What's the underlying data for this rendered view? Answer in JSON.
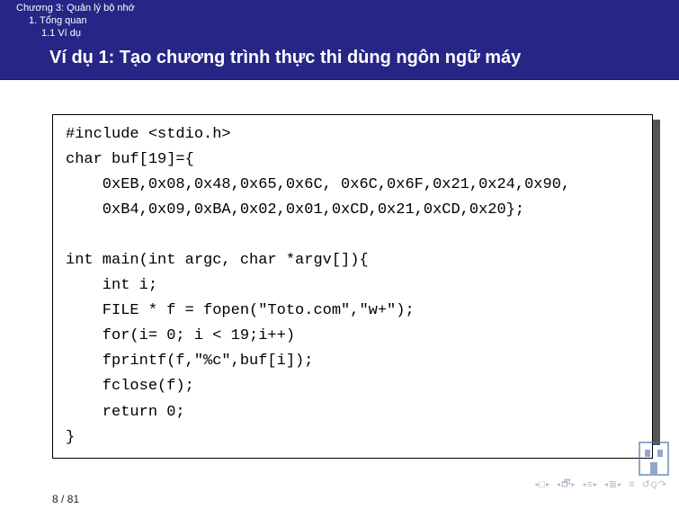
{
  "header": {
    "chapter": "Chương 3: Quản lý bộ nhớ",
    "section": "1. Tổng quan",
    "subsection": "1.1 Ví dụ"
  },
  "title": "Ví dụ 1: Tạo chương trình thực thi dùng ngôn ngữ máy",
  "code_lines": [
    "#include <stdio.h>",
    "char buf[19]={",
    "    0xEB,0x08,0x48,0x65,0x6C, 0x6C,0x6F,0x21,0x24,0x90,",
    "    0xB4,0x09,0xBA,0x02,0x01,0xCD,0x21,0xCD,0x20};",
    "",
    "int main(int argc, char *argv[]){",
    "    int i;",
    "    FILE * f = fopen(\"Toto.com\",\"w+\");",
    "    for(i= 0; i < 19;i++)",
    "    fprintf(f,\"%c\",buf[i]);",
    "    fclose(f);",
    "    return 0;",
    "}"
  ],
  "nav": {
    "first": "◂ □ ▸",
    "prev": "◂ 🗗 ▸",
    "back": "◂ ≡ ▸",
    "fwd": "◂ ≣ ▸",
    "section": "≡",
    "undo": "↺ Q ↷"
  },
  "page": {
    "current": 8,
    "total": 81,
    "sep": " / "
  },
  "colors": {
    "header_bg": "#262686"
  }
}
